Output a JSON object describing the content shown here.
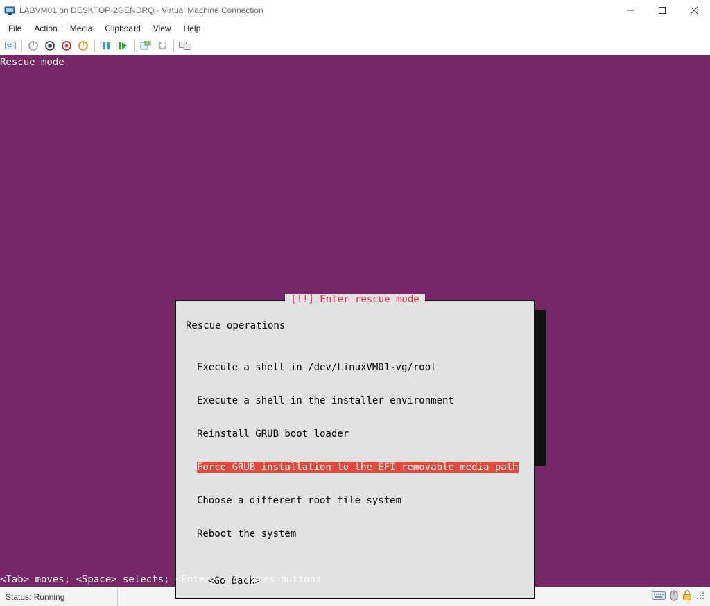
{
  "window": {
    "title": "LABVM01 on DESKTOP-2GENDRQ - Virtual Machine Connection"
  },
  "menubar": {
    "items": [
      "File",
      "Action",
      "Media",
      "Clipboard",
      "View",
      "Help"
    ]
  },
  "toolbar": {
    "icons": [
      "ctrl-alt-del-icon",
      "start-icon",
      "turnoff-icon",
      "shutdown-icon",
      "save-icon",
      "pause-icon",
      "reset-icon",
      "checkpoint-icon",
      "revert-icon",
      "enhanced-session-icon"
    ]
  },
  "vm": {
    "header": "Rescue mode",
    "footer": "<Tab> moves; <Space> selects; <Enter> activates buttons",
    "dialog": {
      "title": "[!!] Enter rescue mode",
      "section": "Rescue operations",
      "options": [
        "Execute a shell in /dev/LinuxVM01-vg/root",
        "Execute a shell in the installer environment",
        "Reinstall GRUB boot loader",
        "Force GRUB installation to the EFI removable media path",
        "Choose a different root file system",
        "Reboot the system"
      ],
      "selected_index": 3,
      "go_back": "<Go Back>"
    }
  },
  "status": {
    "text": "Status: Running"
  }
}
